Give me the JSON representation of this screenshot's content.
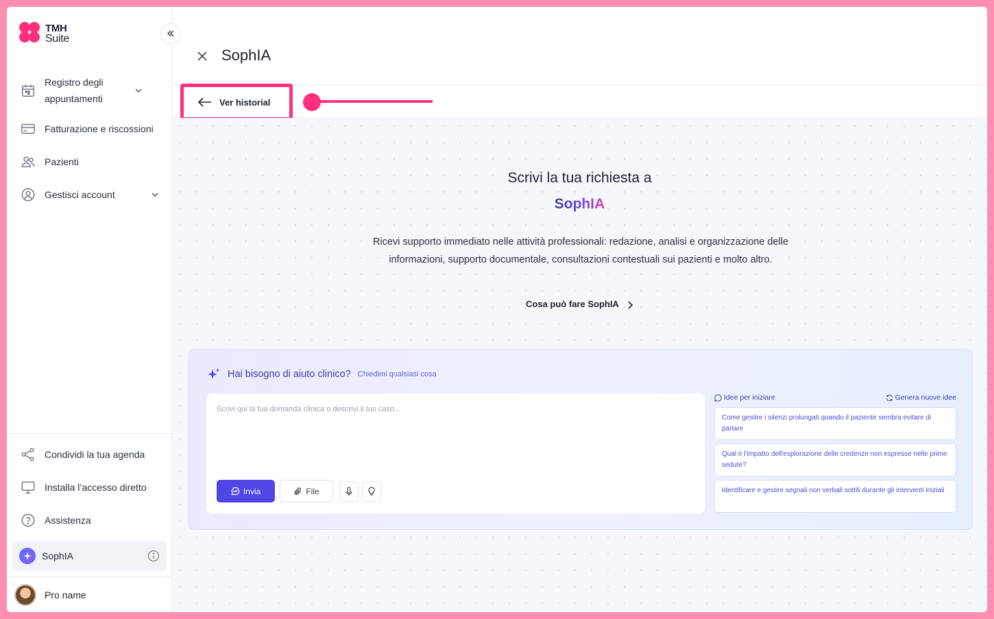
{
  "app": {
    "logo_line1": "TMH",
    "logo_line2": "Suite",
    "title": "SophIA"
  },
  "sidebar": {
    "items": [
      {
        "label": "Registro degli appuntamenti",
        "icon": "calendar-icon",
        "has_chevron": true
      },
      {
        "label": "Fatturazione e riscossioni",
        "icon": "credit-card-icon"
      },
      {
        "label": "Pazienti",
        "icon": "users-icon"
      },
      {
        "label": "Gestisci account",
        "icon": "user-circle-icon",
        "has_chevron": true
      }
    ],
    "bottom_items": [
      {
        "label": "Condividi la tua agenda",
        "icon": "share-icon"
      },
      {
        "label": "Installa l’accesso diretto",
        "icon": "monitor-icon"
      },
      {
        "label": "Assistenza",
        "icon": "help-circle-icon"
      }
    ],
    "sophia_item": {
      "label": "SophIA",
      "icon": "sparkle-icon"
    },
    "profile": {
      "name": "Pro name"
    }
  },
  "header": {
    "history_button": "Ver historial"
  },
  "hero": {
    "title": "Scrivi la tua richiesta a",
    "brand": "SophIA",
    "description": "Ricevi supporto immediato nelle attività professionali: redazione, analisi e organizzazione delle informazioni, supporto documentale, consultazioni contestuali sui pazienti e molto altro.",
    "link": "Cosa può fare SophIA"
  },
  "assistant": {
    "heading": "Hai bisogno di aiuto clinico?",
    "subheading": "Chiedimi qualsiasi cosa",
    "placeholder": "Scrivi qui la tua domanda clinica o descrivi il tuo caso...",
    "send_label": "Invia",
    "file_label": "File",
    "ideas_title": "Idee per iniziare",
    "ideas_refresh": "Genera nuove idee",
    "ideas": [
      "Come gestire i silenzi prolungati quando il paziente sembra evitare di parlare",
      "Qual è l'impatto dell'esplorazione delle credenze non espresse nelle prime sedute?",
      "Identificare e gestire segnali non verbali sottili durante gli interventi iniziali"
    ]
  },
  "colors": {
    "accent": "#ff2e7e",
    "primary": "#4f46e5",
    "brand_gradient_start": "#3b3f8f",
    "brand_gradient_end": "#e0459b"
  }
}
